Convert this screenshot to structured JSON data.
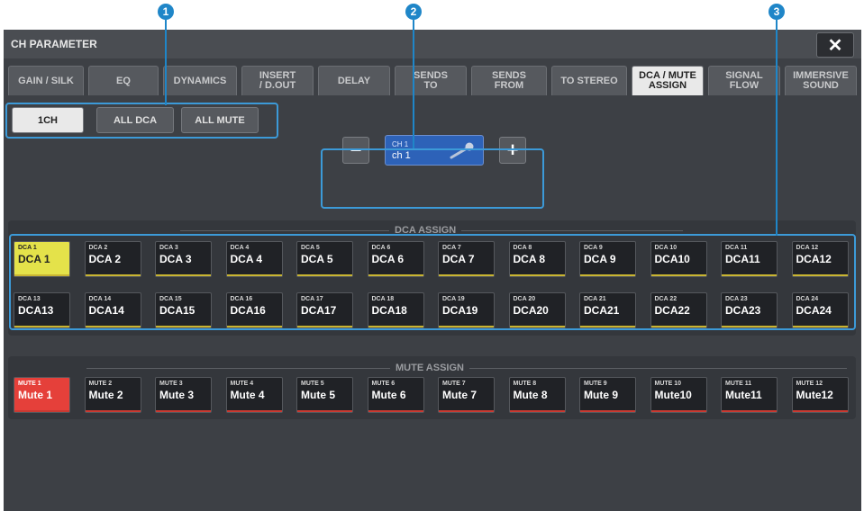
{
  "callouts": [
    "1",
    "2",
    "3"
  ],
  "window": {
    "title": "CH PARAMETER",
    "close_label": "✕"
  },
  "tabs": [
    {
      "label": "GAIN / SILK"
    },
    {
      "label": "EQ"
    },
    {
      "label": "DYNAMICS"
    },
    {
      "label": "INSERT\n/ D.OUT"
    },
    {
      "label": "DELAY"
    },
    {
      "label": "SENDS\nTO"
    },
    {
      "label": "SENDS\nFROM"
    },
    {
      "label": "TO STEREO"
    },
    {
      "label": "DCA / MUTE\nASSIGN"
    },
    {
      "label": "SIGNAL\nFLOW"
    },
    {
      "label": "IMMERSIVE\nSOUND"
    }
  ],
  "active_tab": "DCA / MUTE ASSIGN",
  "subtabs": [
    {
      "label": "1CH"
    },
    {
      "label": "ALL DCA"
    },
    {
      "label": "ALL MUTE"
    }
  ],
  "active_subtab": "1CH",
  "channel": {
    "number": "CH 1",
    "name": "ch 1",
    "minus_label": "−",
    "plus_label": "+"
  },
  "dca_assign": {
    "label": "DCA ASSIGN",
    "items": [
      {
        "num": "DCA 1",
        "name": "DCA 1",
        "on": true
      },
      {
        "num": "DCA 2",
        "name": "DCA 2",
        "on": false
      },
      {
        "num": "DCA 3",
        "name": "DCA 3",
        "on": false
      },
      {
        "num": "DCA 4",
        "name": "DCA 4",
        "on": false
      },
      {
        "num": "DCA 5",
        "name": "DCA 5",
        "on": false
      },
      {
        "num": "DCA 6",
        "name": "DCA 6",
        "on": false
      },
      {
        "num": "DCA 7",
        "name": "DCA 7",
        "on": false
      },
      {
        "num": "DCA 8",
        "name": "DCA 8",
        "on": false
      },
      {
        "num": "DCA 9",
        "name": "DCA 9",
        "on": false
      },
      {
        "num": "DCA 10",
        "name": "DCA10",
        "on": false
      },
      {
        "num": "DCA 11",
        "name": "DCA11",
        "on": false
      },
      {
        "num": "DCA 12",
        "name": "DCA12",
        "on": false
      },
      {
        "num": "DCA 13",
        "name": "DCA13",
        "on": false
      },
      {
        "num": "DCA 14",
        "name": "DCA14",
        "on": false
      },
      {
        "num": "DCA 15",
        "name": "DCA15",
        "on": false
      },
      {
        "num": "DCA 16",
        "name": "DCA16",
        "on": false
      },
      {
        "num": "DCA 17",
        "name": "DCA17",
        "on": false
      },
      {
        "num": "DCA 18",
        "name": "DCA18",
        "on": false
      },
      {
        "num": "DCA 19",
        "name": "DCA19",
        "on": false
      },
      {
        "num": "DCA 20",
        "name": "DCA20",
        "on": false
      },
      {
        "num": "DCA 21",
        "name": "DCA21",
        "on": false
      },
      {
        "num": "DCA 22",
        "name": "DCA22",
        "on": false
      },
      {
        "num": "DCA 23",
        "name": "DCA23",
        "on": false
      },
      {
        "num": "DCA 24",
        "name": "DCA24",
        "on": false
      }
    ]
  },
  "mute_assign": {
    "label": "MUTE ASSIGN",
    "items": [
      {
        "num": "MUTE 1",
        "name": "Mute 1",
        "on": true
      },
      {
        "num": "MUTE 2",
        "name": "Mute 2",
        "on": false
      },
      {
        "num": "MUTE 3",
        "name": "Mute 3",
        "on": false
      },
      {
        "num": "MUTE 4",
        "name": "Mute 4",
        "on": false
      },
      {
        "num": "MUTE 5",
        "name": "Mute 5",
        "on": false
      },
      {
        "num": "MUTE 6",
        "name": "Mute 6",
        "on": false
      },
      {
        "num": "MUTE 7",
        "name": "Mute 7",
        "on": false
      },
      {
        "num": "MUTE 8",
        "name": "Mute 8",
        "on": false
      },
      {
        "num": "MUTE 9",
        "name": "Mute 9",
        "on": false
      },
      {
        "num": "MUTE 10",
        "name": "Mute10",
        "on": false
      },
      {
        "num": "MUTE 11",
        "name": "Mute11",
        "on": false
      },
      {
        "num": "MUTE 12",
        "name": "Mute12",
        "on": false
      }
    ]
  },
  "colors": {
    "accent": "#3c9ad8",
    "dca_on": "#e4e24a",
    "mute_on": "#e5403a"
  }
}
